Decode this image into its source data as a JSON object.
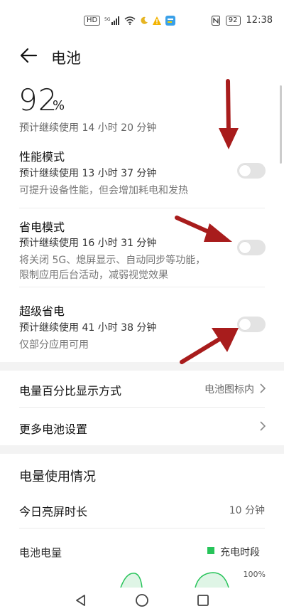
{
  "status_bar": {
    "left_icons": [
      "hd-icon",
      "signal-5g-icon",
      "wifi-icon",
      "moon-icon",
      "warning-icon",
      "app-notification-icon"
    ],
    "battery_level": "92",
    "time": "12:38"
  },
  "header": {
    "title": "电池"
  },
  "battery": {
    "percent_value": "92",
    "percent_unit": "%",
    "estimate": "预计继续使用 14 小时 20 分钟"
  },
  "modes": [
    {
      "title": "性能模式",
      "estimate": "预计继续使用 13 小时 37 分钟",
      "desc1": "可提升设备性能，但会增加耗电和发热",
      "desc2": "",
      "enabled": false
    },
    {
      "title": "省电模式",
      "estimate": "预计继续使用 16 小时 31 分钟",
      "desc1": "将关闭 5G、熄屏显示、自动同步等功能，",
      "desc2": "限制应用后台活动，减弱视觉效果",
      "enabled": false
    },
    {
      "title": "超级省电",
      "estimate": "预计继续使用 41 小时 38 分钟",
      "desc1": "仅部分应用可用",
      "desc2": "",
      "enabled": false
    }
  ],
  "settings": {
    "percent_display_label": "电量百分比显示方式",
    "percent_display_value": "电池图标内",
    "more_settings_label": "更多电池设置"
  },
  "usage": {
    "section_title": "电量使用情况",
    "screen_time_label": "今日亮屏时长",
    "screen_time_value": "10 分钟",
    "battery_level_label": "电池电量",
    "legend_charging": "充电时段",
    "axis_top": "100%"
  },
  "colors": {
    "accent_green": "#27c45a",
    "arrow_red": "#a81c1c",
    "toggle_off": "#e3e3e3"
  }
}
